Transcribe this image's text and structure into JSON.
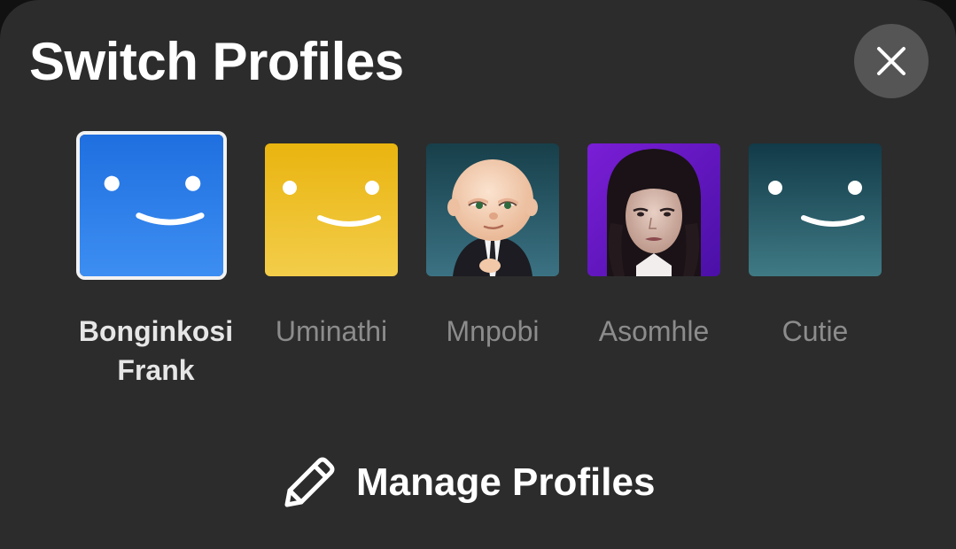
{
  "header": {
    "title": "Switch Profiles",
    "close_icon": "close-icon"
  },
  "profiles": [
    {
      "name": "Bonginkosi Frank",
      "avatar": "smile-face-blue",
      "selected": true,
      "color": "#2f7ee8"
    },
    {
      "name": "Uminathi",
      "avatar": "smile-face-yellow",
      "selected": false,
      "color": "#f0c12c"
    },
    {
      "name": "Mnpobi",
      "avatar": "boss-baby-photo",
      "selected": false
    },
    {
      "name": "Asomhle",
      "avatar": "wednesday-photo",
      "selected": false
    },
    {
      "name": "Cutie",
      "avatar": "smile-face-teal",
      "selected": false,
      "color": "#2b6670"
    }
  ],
  "footer": {
    "manage_label": "Manage Profiles",
    "manage_icon": "pencil-icon"
  },
  "colors": {
    "sheet_background": "#2c2c2c",
    "close_button": "#555555",
    "selected_border": "#f2f2f2",
    "inactive_text": "#8c8c8c"
  }
}
